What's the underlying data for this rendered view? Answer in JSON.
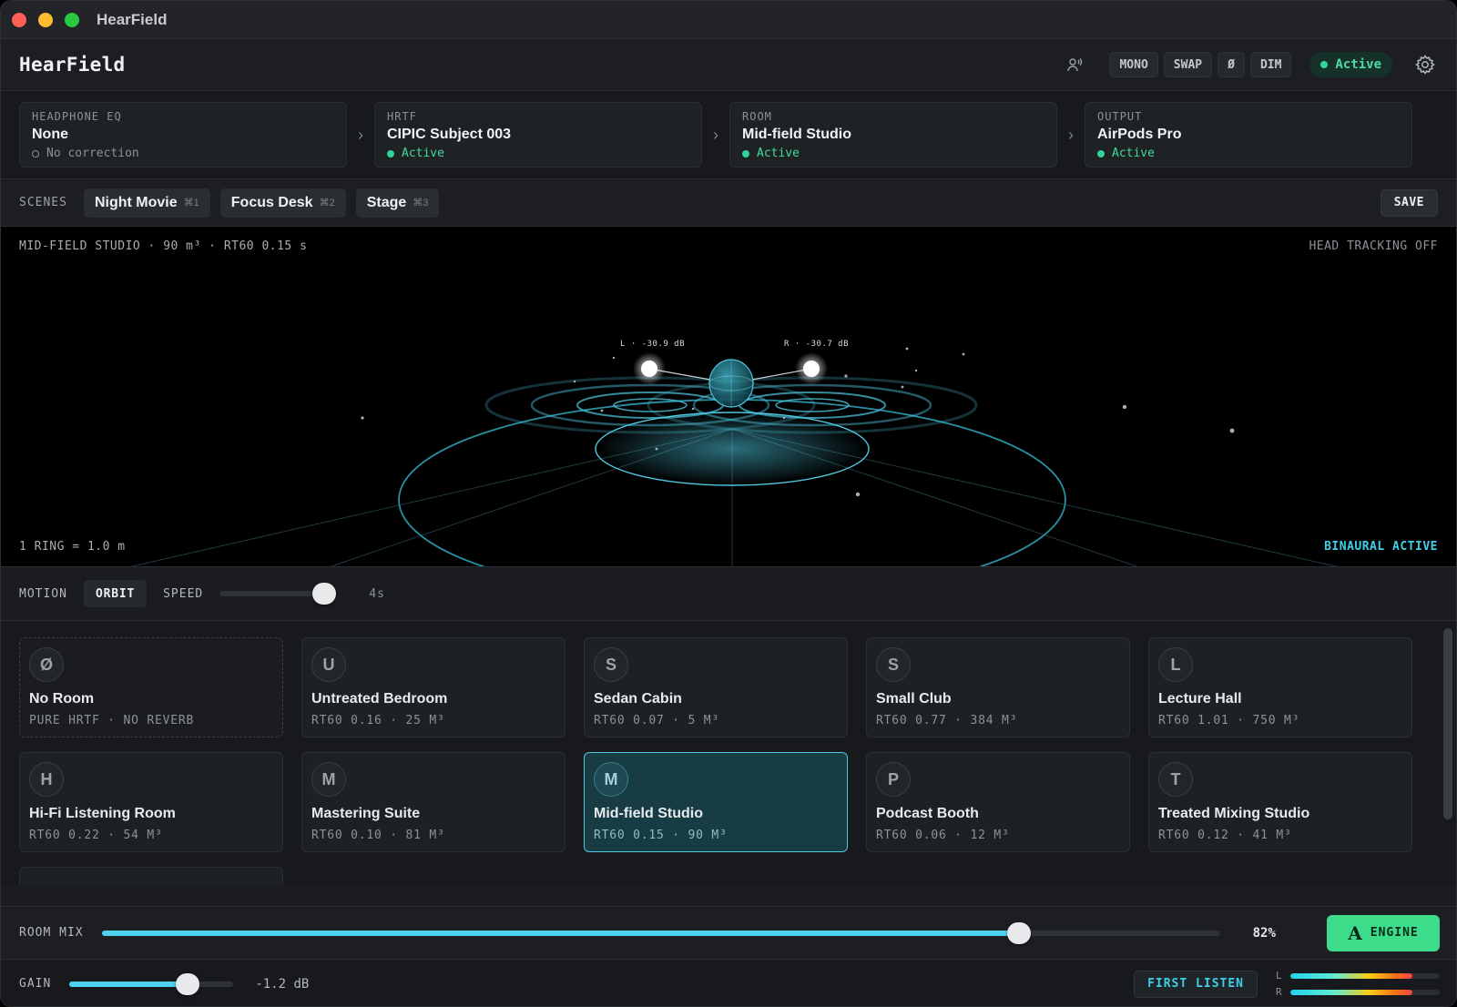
{
  "window": {
    "title": "HearField"
  },
  "header": {
    "brand": "HearField",
    "buttons": [
      "MONO",
      "SWAP",
      "Ø",
      "DIM"
    ],
    "status": "Active"
  },
  "chain": [
    {
      "label": "HEADPHONE EQ",
      "value": "None",
      "status": "No correction",
      "active": false
    },
    {
      "label": "HRTF",
      "value": "CIPIC Subject 003",
      "status": "Active",
      "active": true
    },
    {
      "label": "ROOM",
      "value": "Mid-field Studio",
      "status": "Active",
      "active": true
    },
    {
      "label": "OUTPUT",
      "value": "AirPods Pro",
      "status": "Active",
      "active": true
    }
  ],
  "scenes": {
    "label": "SCENES",
    "items": [
      {
        "name": "Night Movie",
        "shortcut": "⌘1"
      },
      {
        "name": "Focus Desk",
        "shortcut": "⌘2"
      },
      {
        "name": "Stage",
        "shortcut": "⌘3"
      }
    ],
    "save_label": "SAVE"
  },
  "viz": {
    "info": "MID-FIELD STUDIO · 90 m³ · RT60 0.15 s",
    "head_tracking": "HEAD TRACKING OFF",
    "scale": "1 RING = 1.0 m",
    "mode": "BINAURAL ACTIVE",
    "left_label": "L · -30.9 dB",
    "right_label": "R · -30.7 dB",
    "accent": "#4fc7df"
  },
  "motion": {
    "label": "MOTION",
    "mode": "ORBIT",
    "speed_label": "SPEED",
    "speed_value": "4s",
    "speed_fraction": 0.9
  },
  "rooms": [
    {
      "letter": "Ø",
      "name": "No Room",
      "meta": "PURE HRTF · NO REVERB",
      "style": "dashed"
    },
    {
      "letter": "U",
      "name": "Untreated Bedroom",
      "meta": "RT60 0.16 · 25 M³"
    },
    {
      "letter": "S",
      "name": "Sedan Cabin",
      "meta": "RT60 0.07 · 5 M³"
    },
    {
      "letter": "S",
      "name": "Small Club",
      "meta": "RT60 0.77 · 384 M³"
    },
    {
      "letter": "L",
      "name": "Lecture Hall",
      "meta": "RT60 1.01 · 750 M³"
    },
    {
      "letter": "H",
      "name": "Hi-Fi Listening Room",
      "meta": "RT60 0.22 · 54 M³"
    },
    {
      "letter": "M",
      "name": "Mastering Suite",
      "meta": "RT60 0.10 · 81 M³"
    },
    {
      "letter": "M",
      "name": "Mid-field Studio",
      "meta": "RT60 0.15 · 90 M³",
      "style": "selected"
    },
    {
      "letter": "P",
      "name": "Podcast Booth",
      "meta": "RT60 0.06 · 12 M³"
    },
    {
      "letter": "T",
      "name": "Treated Mixing Studio",
      "meta": "RT60 0.12 · 41 M³"
    },
    {
      "letter": "",
      "name": "",
      "meta": ""
    }
  ],
  "room_mix": {
    "label": "ROOM MIX",
    "value": "82%",
    "fraction": 0.82,
    "engine_letter": "A",
    "engine_label": "ENGINE"
  },
  "gain": {
    "label": "GAIN",
    "value": "-1.2 dB",
    "fraction": 0.72
  },
  "first_listen": "FIRST LISTEN",
  "meters": {
    "left_label": "L",
    "right_label": "R",
    "left_level": 0.82,
    "right_level": 0.82
  }
}
